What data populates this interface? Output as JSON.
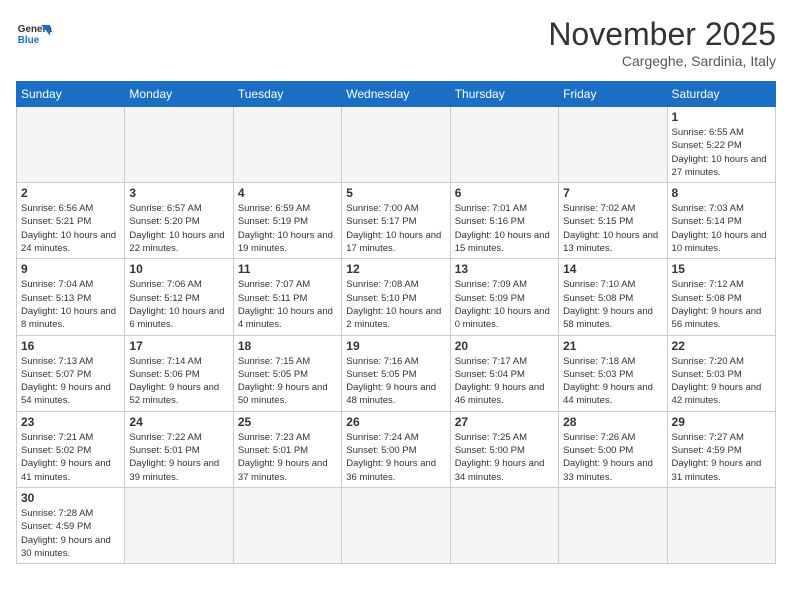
{
  "header": {
    "logo_general": "General",
    "logo_blue": "Blue",
    "title": "November 2025",
    "subtitle": "Cargeghe, Sardinia, Italy"
  },
  "days_of_week": [
    "Sunday",
    "Monday",
    "Tuesday",
    "Wednesday",
    "Thursday",
    "Friday",
    "Saturday"
  ],
  "weeks": [
    [
      {
        "day": "",
        "info": ""
      },
      {
        "day": "",
        "info": ""
      },
      {
        "day": "",
        "info": ""
      },
      {
        "day": "",
        "info": ""
      },
      {
        "day": "",
        "info": ""
      },
      {
        "day": "",
        "info": ""
      },
      {
        "day": "1",
        "info": "Sunrise: 6:55 AM\nSunset: 5:22 PM\nDaylight: 10 hours and 27 minutes."
      }
    ],
    [
      {
        "day": "2",
        "info": "Sunrise: 6:56 AM\nSunset: 5:21 PM\nDaylight: 10 hours and 24 minutes."
      },
      {
        "day": "3",
        "info": "Sunrise: 6:57 AM\nSunset: 5:20 PM\nDaylight: 10 hours and 22 minutes."
      },
      {
        "day": "4",
        "info": "Sunrise: 6:59 AM\nSunset: 5:19 PM\nDaylight: 10 hours and 19 minutes."
      },
      {
        "day": "5",
        "info": "Sunrise: 7:00 AM\nSunset: 5:17 PM\nDaylight: 10 hours and 17 minutes."
      },
      {
        "day": "6",
        "info": "Sunrise: 7:01 AM\nSunset: 5:16 PM\nDaylight: 10 hours and 15 minutes."
      },
      {
        "day": "7",
        "info": "Sunrise: 7:02 AM\nSunset: 5:15 PM\nDaylight: 10 hours and 13 minutes."
      },
      {
        "day": "8",
        "info": "Sunrise: 7:03 AM\nSunset: 5:14 PM\nDaylight: 10 hours and 10 minutes."
      }
    ],
    [
      {
        "day": "9",
        "info": "Sunrise: 7:04 AM\nSunset: 5:13 PM\nDaylight: 10 hours and 8 minutes."
      },
      {
        "day": "10",
        "info": "Sunrise: 7:06 AM\nSunset: 5:12 PM\nDaylight: 10 hours and 6 minutes."
      },
      {
        "day": "11",
        "info": "Sunrise: 7:07 AM\nSunset: 5:11 PM\nDaylight: 10 hours and 4 minutes."
      },
      {
        "day": "12",
        "info": "Sunrise: 7:08 AM\nSunset: 5:10 PM\nDaylight: 10 hours and 2 minutes."
      },
      {
        "day": "13",
        "info": "Sunrise: 7:09 AM\nSunset: 5:09 PM\nDaylight: 10 hours and 0 minutes."
      },
      {
        "day": "14",
        "info": "Sunrise: 7:10 AM\nSunset: 5:08 PM\nDaylight: 9 hours and 58 minutes."
      },
      {
        "day": "15",
        "info": "Sunrise: 7:12 AM\nSunset: 5:08 PM\nDaylight: 9 hours and 56 minutes."
      }
    ],
    [
      {
        "day": "16",
        "info": "Sunrise: 7:13 AM\nSunset: 5:07 PM\nDaylight: 9 hours and 54 minutes."
      },
      {
        "day": "17",
        "info": "Sunrise: 7:14 AM\nSunset: 5:06 PM\nDaylight: 9 hours and 52 minutes."
      },
      {
        "day": "18",
        "info": "Sunrise: 7:15 AM\nSunset: 5:05 PM\nDaylight: 9 hours and 50 minutes."
      },
      {
        "day": "19",
        "info": "Sunrise: 7:16 AM\nSunset: 5:05 PM\nDaylight: 9 hours and 48 minutes."
      },
      {
        "day": "20",
        "info": "Sunrise: 7:17 AM\nSunset: 5:04 PM\nDaylight: 9 hours and 46 minutes."
      },
      {
        "day": "21",
        "info": "Sunrise: 7:18 AM\nSunset: 5:03 PM\nDaylight: 9 hours and 44 minutes."
      },
      {
        "day": "22",
        "info": "Sunrise: 7:20 AM\nSunset: 5:03 PM\nDaylight: 9 hours and 42 minutes."
      }
    ],
    [
      {
        "day": "23",
        "info": "Sunrise: 7:21 AM\nSunset: 5:02 PM\nDaylight: 9 hours and 41 minutes."
      },
      {
        "day": "24",
        "info": "Sunrise: 7:22 AM\nSunset: 5:01 PM\nDaylight: 9 hours and 39 minutes."
      },
      {
        "day": "25",
        "info": "Sunrise: 7:23 AM\nSunset: 5:01 PM\nDaylight: 9 hours and 37 minutes."
      },
      {
        "day": "26",
        "info": "Sunrise: 7:24 AM\nSunset: 5:00 PM\nDaylight: 9 hours and 36 minutes."
      },
      {
        "day": "27",
        "info": "Sunrise: 7:25 AM\nSunset: 5:00 PM\nDaylight: 9 hours and 34 minutes."
      },
      {
        "day": "28",
        "info": "Sunrise: 7:26 AM\nSunset: 5:00 PM\nDaylight: 9 hours and 33 minutes."
      },
      {
        "day": "29",
        "info": "Sunrise: 7:27 AM\nSunset: 4:59 PM\nDaylight: 9 hours and 31 minutes."
      }
    ],
    [
      {
        "day": "30",
        "info": "Sunrise: 7:28 AM\nSunset: 4:59 PM\nDaylight: 9 hours and 30 minutes."
      },
      {
        "day": "",
        "info": ""
      },
      {
        "day": "",
        "info": ""
      },
      {
        "day": "",
        "info": ""
      },
      {
        "day": "",
        "info": ""
      },
      {
        "day": "",
        "info": ""
      },
      {
        "day": "",
        "info": ""
      }
    ]
  ]
}
